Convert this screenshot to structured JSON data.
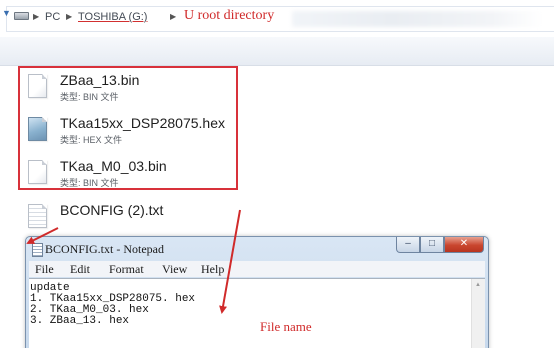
{
  "address_bar": {
    "crumbs": [
      "PC",
      "TOSHIBA (G:)"
    ],
    "callout": "U root directory"
  },
  "files": [
    {
      "name": "ZBaa_13.bin",
      "type": "类型: BIN 文件",
      "icon": "bin-file-icon"
    },
    {
      "name": "TKaa15xx_DSP28075.hex",
      "type": "类型: HEX 文件",
      "icon": "hex-file-icon"
    },
    {
      "name": "TKaa_M0_03.bin",
      "type": "类型: BIN 文件",
      "icon": "bin-file-icon"
    },
    {
      "name": "BCONFIG (2).txt",
      "type": "",
      "icon": "text-file-icon"
    }
  ],
  "notepad": {
    "title": "BCONFIG.txt - Notepad",
    "menu": [
      "File",
      "Edit",
      "Format",
      "View",
      "Help"
    ],
    "controls": {
      "minimize": "–",
      "maximize": "□",
      "close": "✕"
    },
    "lines": [
      "update",
      "1. TKaa15xx_DSP28075. hex",
      "2. TKaa_M0_03. hex",
      "3. ZBaa_13. hex"
    ]
  },
  "annotations": {
    "file_name_label": "File name"
  },
  "colors": {
    "annotation_red": "#d02a2a",
    "box_red": "#d8313a"
  }
}
